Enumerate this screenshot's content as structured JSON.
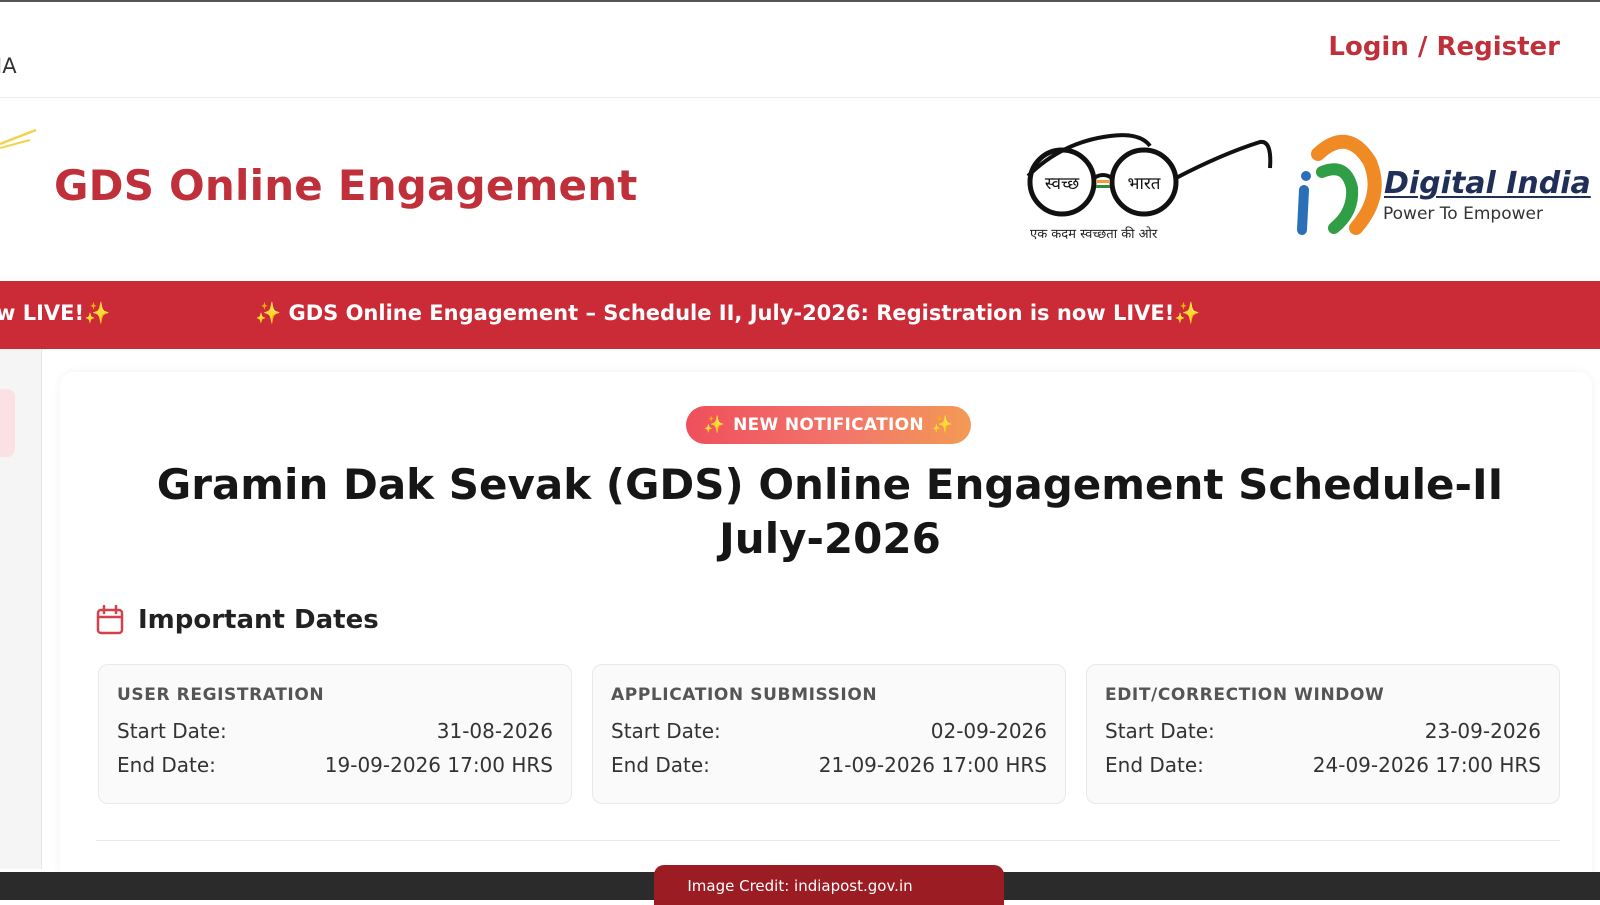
{
  "topbar": {
    "left_text": "IA",
    "login_label": "Login / Register"
  },
  "header": {
    "site_title": "GDS Online Engagement",
    "swachh_left": "स्वच्छ",
    "swachh_right": "भारत",
    "swachh_caption": "एक कदम स्वच्छता की ओर",
    "digital_india_title": "Digital India",
    "digital_india_tagline": "Power To Empower"
  },
  "ticker": {
    "fragment": "w LIVE!",
    "message": "GDS Online Engagement – Schedule II, July-2026: Registration is now LIVE!",
    "spark": "✨"
  },
  "card": {
    "badge": "NEW NOTIFICATION",
    "title_line1": "Gramin Dak Sevak (GDS) Online Engagement Schedule-II",
    "title_line2": "July-2026",
    "section_title": "Important Dates",
    "date_cards": [
      {
        "title": "USER REGISTRATION",
        "start_label": "Start Date:",
        "start_value": "31-08-2026",
        "end_label": "End Date:",
        "end_value": "19-09-2026 17:00 HRS"
      },
      {
        "title": "APPLICATION SUBMISSION",
        "start_label": "Start Date:",
        "start_value": "02-09-2026",
        "end_label": "End Date:",
        "end_value": "21-09-2026 17:00 HRS"
      },
      {
        "title": "EDIT/CORRECTION WINDOW",
        "start_label": "Start Date:",
        "start_value": "23-09-2026",
        "end_label": "End Date:",
        "end_value": "24-09-2026 17:00 HRS"
      }
    ]
  },
  "credit": "Image Credit: indiapost.gov.in",
  "colors": {
    "brand_red": "#c0303a",
    "ticker_red": "#cb2b37",
    "badge_gradient_start": "#ef4f5c",
    "badge_gradient_end": "#f39a54"
  }
}
